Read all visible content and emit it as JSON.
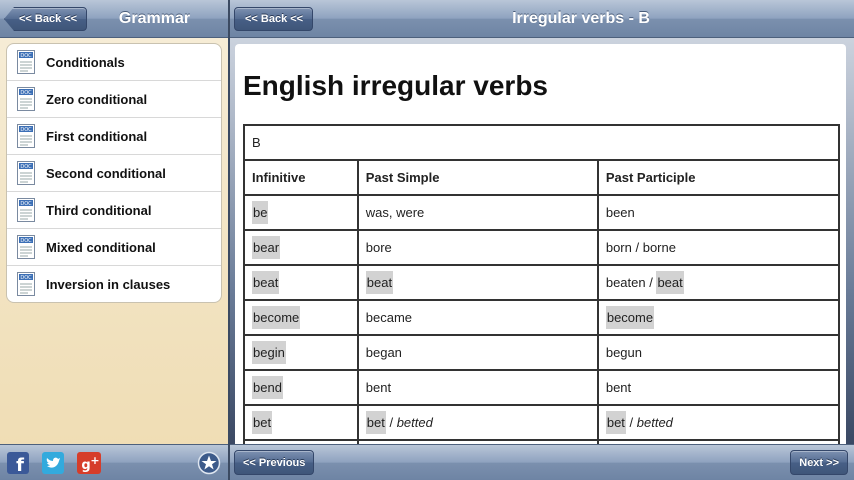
{
  "left": {
    "back_label": "<< Back <<",
    "title": "Grammar",
    "items": [
      {
        "label": "Conditionals"
      },
      {
        "label": "Zero conditional"
      },
      {
        "label": "First conditional"
      },
      {
        "label": "Second conditional"
      },
      {
        "label": "Third conditional"
      },
      {
        "label": "Mixed conditional"
      },
      {
        "label": "Inversion in clauses"
      }
    ],
    "social_icons": [
      "facebook-icon",
      "twitter-icon",
      "google-plus-icon",
      "star-icon"
    ]
  },
  "right": {
    "back_label": "<< Back <<",
    "title": "Irregular verbs - B",
    "heading": "English irregular verbs",
    "prev_label": "<< Previous",
    "next_label": "Next >>",
    "table": {
      "section": "B",
      "headers": [
        "Infinitive",
        "Past Simple",
        "Past Participle"
      ],
      "rows": [
        {
          "inf": "be",
          "past": "was, were",
          "pp": "been"
        },
        {
          "inf": "bear",
          "past": "bore",
          "pp": "born",
          "pp_sep": " / ",
          "pp_alt": "borne"
        },
        {
          "inf": "beat",
          "past": "beat",
          "pp": "beaten",
          "pp_sep": " / ",
          "pp_alt": "beat"
        },
        {
          "inf": "become",
          "past": "became",
          "pp": "become"
        },
        {
          "inf": "begin",
          "past": "began",
          "pp": "begun"
        },
        {
          "inf": "bend",
          "past": "bent",
          "pp": "bent"
        },
        {
          "inf": "bet",
          "past": "bet",
          "past_sep": " / ",
          "past_alt": "betted",
          "pp": "bet",
          "pp_sep": " / ",
          "pp_alt": "betted"
        }
      ]
    }
  },
  "colors": {
    "bar": "#8ea2bf",
    "button": "#475f86",
    "highlight": "#d2d2d2",
    "left_bg": "#f3e6c8"
  }
}
